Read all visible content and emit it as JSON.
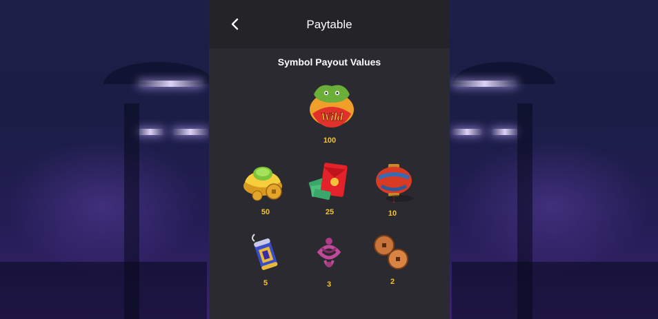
{
  "header": {
    "title": "Paytable",
    "back_icon": "chevron-left-icon"
  },
  "section": {
    "title": "Symbol Payout Values"
  },
  "symbols": [
    {
      "icon": "dragon-wild-icon",
      "label": "Wild",
      "value": "100"
    },
    {
      "icon": "gold-ingot-icon",
      "value": "50"
    },
    {
      "icon": "red-envelope-icon",
      "value": "25"
    },
    {
      "icon": "lantern-icon",
      "value": "10"
    },
    {
      "icon": "firecracker-icon",
      "value": "5"
    },
    {
      "icon": "chinese-knot-icon",
      "value": "3"
    },
    {
      "icon": "coins-icon",
      "value": "2"
    }
  ],
  "colors": {
    "panel": "#2a2a30",
    "header": "#242428",
    "value_text": "#f3c52a"
  }
}
